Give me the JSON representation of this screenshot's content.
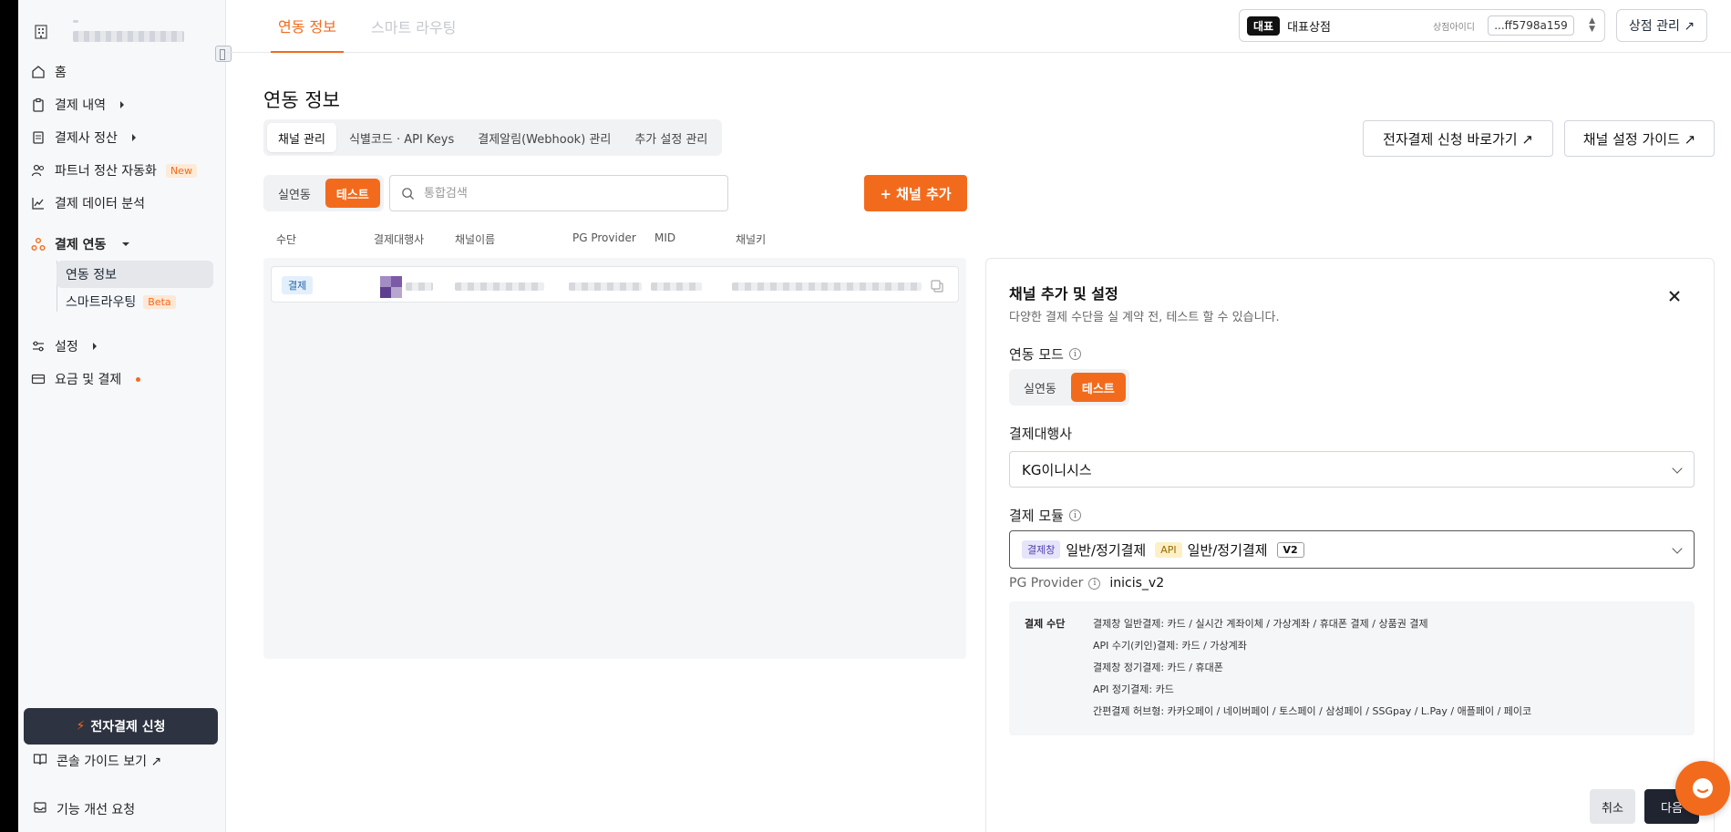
{
  "sidebar": {
    "nav": [
      {
        "label": "홈"
      },
      {
        "label": "결제 내역"
      },
      {
        "label": "결제사 정산"
      },
      {
        "label": "파트너 정산 자동화",
        "badge": "New"
      },
      {
        "label": "결제 데이터 분석"
      },
      {
        "label": "결제 연동"
      },
      {
        "label": "설정"
      },
      {
        "label": "요금 및 결제"
      }
    ],
    "sub": [
      {
        "label": "연동 정보"
      },
      {
        "label": "스마트라우팅",
        "badge": "Beta"
      }
    ],
    "apply_label": "전자결제 신청",
    "guide_label": "콘솔 가이드 보기 ↗",
    "feedback_label": "기능 개선 요청"
  },
  "topbar": {
    "tabs": [
      "연동 정보",
      "스마트 라우팅"
    ],
    "store": {
      "badge": "대표",
      "name": "대표상점",
      "id_label": "상점아이디",
      "id_value": "...ff5798a159"
    },
    "manage_label": "상점 관리 ↗"
  },
  "main": {
    "title": "연동 정보",
    "subtabs": [
      "채널 관리",
      "식별코드 · API Keys",
      "결제알림(Webhook) 관리",
      "추가 설정 관리"
    ],
    "apply_shortcut": "전자결제 신청 바로가기 ↗",
    "channel_guide": "채널 설정 가이드 ↗",
    "mode_options": [
      "실연동",
      "테스트"
    ],
    "search_placeholder": "통합검색",
    "add_channel": "+ 채널 추가",
    "columns": [
      "수단",
      "결제대행사",
      "채널이름",
      "PG Provider",
      "MID",
      "채널키"
    ],
    "row": {
      "method": "결제"
    }
  },
  "drawer": {
    "title": "채널 추가 및 설정",
    "subtitle": "다양한 결제 수단을 실 계약 전, 테스트 할 수 있습니다.",
    "mode_label": "연동 모드",
    "mode_options": [
      "실연동",
      "테스트"
    ],
    "pg_label": "결제대행사",
    "pg_value": "KG이니시스",
    "module_label": "결제 모듈",
    "module": {
      "badge1": "결제창",
      "text1": "일반/정기결제",
      "badge2": "API",
      "text2": "일반/정기결제",
      "version": "V2"
    },
    "provider_label": "PG Provider",
    "provider_value": "inicis_v2",
    "methods_label": "결제 수단",
    "methods": [
      "결제창 일반결제: 카드 / 실시간 계좌이체 / 가상계좌 / 휴대폰 결제 / 상품권 결제",
      "API 수기(키인)결제: 카드 / 가상계좌",
      "결제창 정기결제: 카드 / 휴대폰",
      "API 정기결제: 카드",
      "간편결제 허브형: 카카오페이 / 네이버페이 / 토스페이 / 삼성페이 / SSGpay / L.Pay / 애플페이 / 페이코"
    ],
    "cancel_label": "취소",
    "next_label": "다음"
  },
  "colors": {
    "accent": "#f26b1d",
    "dark": "#1f2430"
  }
}
